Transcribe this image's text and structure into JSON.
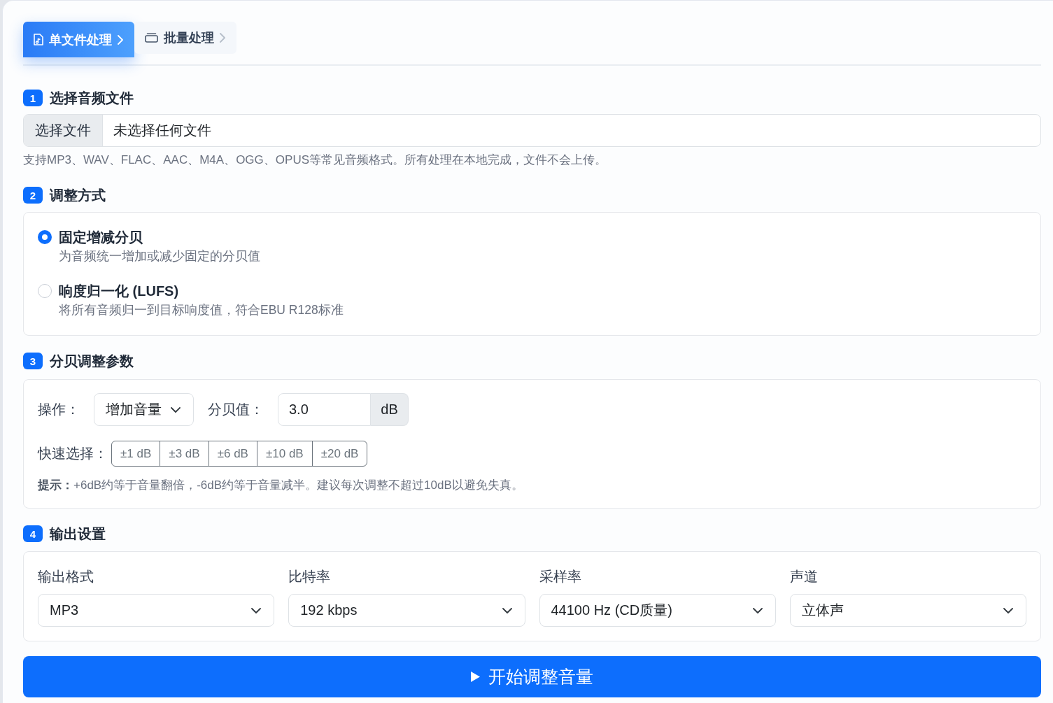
{
  "tabs": [
    {
      "kind": "file",
      "label": "单文件处理",
      "selected": true
    },
    {
      "kind": "batch",
      "label": "批量处理",
      "selected": false
    }
  ],
  "file_section": {
    "number": "1",
    "title": "选择音频文件",
    "file_input": {
      "button": "选择文件",
      "value": "未选择任何文件"
    },
    "help": "支持MP3、WAV、FLAC、AAC、M4A、OGG、OPUS等常见音频格式。所有处理在本地完成，文件不会上传。"
  },
  "mode_section": {
    "number": "2",
    "title": "调整方式",
    "options": [
      {
        "label": "固定增减分贝",
        "description": "为音频统一增加或减少固定的分贝值",
        "selected": true
      },
      {
        "label": "响度归一化 (LUFS)",
        "description": "将所有音频归一到目标响度值，符合EBU R128标准",
        "selected": false
      }
    ]
  },
  "params_section": {
    "number": "3",
    "title": "分贝调整参数",
    "operation": {
      "label": "操作：",
      "value": "增加音量"
    },
    "db_value": {
      "label": "分贝值：",
      "value": "3.0",
      "unit": "dB"
    },
    "quick_select": {
      "label": "快速选择：",
      "buttons": [
        "±1 dB",
        "±3 dB",
        "±6 dB",
        "±10 dB",
        "±20 dB"
      ]
    },
    "hint": "**提示：**+6dB约等于音量翻倍，-6dB约等于音量减半。建议每次调整不超过10dB以避免失真。"
  },
  "output_section": {
    "number": "4",
    "title": "输出设置",
    "fields": [
      {
        "label": "输出格式",
        "value": "MP3"
      },
      {
        "label": "比特率",
        "value": "192 kbps"
      },
      {
        "label": "采样率",
        "value": "44100 Hz (CD质量)"
      },
      {
        "label": "声道",
        "value": "立体声"
      }
    ]
  },
  "start_button": {
    "label": "开始调整音量"
  }
}
